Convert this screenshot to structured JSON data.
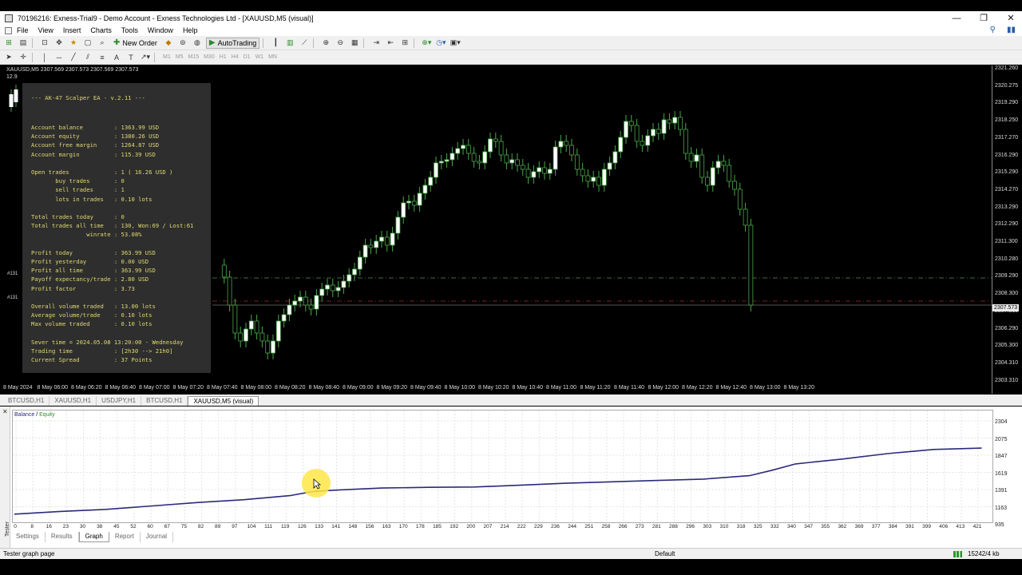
{
  "window": {
    "title": "70196216: Exness-Trial9 - Demo Account - Exness Technologies Ltd - [XAUUSD,M5 (visual)]",
    "controls": [
      "—",
      "❐",
      "✕"
    ]
  },
  "menu": [
    "File",
    "View",
    "Insert",
    "Charts",
    "Tools",
    "Window",
    "Help"
  ],
  "toolbar": {
    "new_order": "New Order",
    "autotrading": "AutoTrading",
    "timeframes": [
      "M1",
      "M5",
      "M15",
      "M30",
      "H1",
      "H4",
      "D1",
      "W1",
      "MN"
    ]
  },
  "chart": {
    "symbol_header": "XAUUSD,M5  2307.569 2307.573 2307.569 2307.573",
    "symbol_sub": "12.9",
    "current_price": "2307.573",
    "order_labels": [
      "#131",
      "#131"
    ],
    "price_labels": [
      "2321.260",
      "2320.275",
      "2319.290",
      "2318.250",
      "2317.270",
      "2316.290",
      "2315.290",
      "2314.270",
      "2313.290",
      "2312.290",
      "2311.300",
      "2310.280",
      "2309.290",
      "2308.300",
      "2307.310",
      "2306.290",
      "2305.300",
      "2304.310",
      "2303.310"
    ],
    "time_labels": [
      "8 May 2024",
      "8 May 06:00",
      "8 May 06:20",
      "8 May 06:40",
      "8 May 07:00",
      "8 May 07:20",
      "8 May 07:40",
      "8 May 08:00",
      "8 May 08:20",
      "8 May 08:40",
      "8 May 09:00",
      "8 May 09:20",
      "8 May 09:40",
      "8 May 10:00",
      "8 May 10:20",
      "8 May 10:40",
      "8 May 11:00",
      "8 May 11:20",
      "8 May 11:40",
      "8 May 12:00",
      "8 May 12:20",
      "8 May 12:40",
      "8 May 13:00",
      "8 May 13:20"
    ]
  },
  "ea_panel": {
    "title": "--- AK-47 Scalper EA - v.2.11 ---",
    "lines": [
      "Account balance         : 1363.99 USD",
      "Account equity          : 1380.26 USD",
      "Account free margin     : 1264.87 USD",
      "Account margin          : 115.39 USD",
      "",
      "Open trades             : 1 ( 16.26 USD )",
      "       buy trades       : 0",
      "       sell trades      : 1",
      "       lots in trades   : 0.10 lots",
      "",
      "Total trades today      : 0",
      "Total trades all time   : 130, Won:69 / Lost:61",
      "                winrate : 53.08%",
      "",
      "Profit today            : 363.99 USD",
      "Profit yesterday        : 0.00 USD",
      "Profit all time         : 363.99 USD",
      "Payoff expectancy/trade : 2.80 USD",
      "Profit factor           : 3.73",
      "",
      "Overall volume traded   : 13.00 lots",
      "Average volume/trade    : 0.10 lots",
      "Max volume traded       : 0.10 lots",
      "",
      "Sever time = 2024.05.08 13:20:00 - Wednesday",
      "Trading time            : [2h30 --> 21h0]",
      "Current Spread          : 37 Points"
    ]
  },
  "symbol_tabs": [
    "BTCUSD,H1",
    "XAUUSD,H1",
    "USDJPY,H1",
    "BTCUSD,H1",
    "XAUUSD,M5 (visual)"
  ],
  "active_symbol_tab": "XAUUSD,M5 (visual)",
  "tester": {
    "side_label": "Tester",
    "legend_balance": "Balance",
    "legend_sep": " / ",
    "legend_equity": "Equity",
    "y_labels": [
      "2304",
      "2075",
      "1847",
      "1619",
      "1391",
      "1163",
      "935"
    ],
    "x_labels": [
      "0",
      "8",
      "16",
      "23",
      "30",
      "38",
      "45",
      "52",
      "60",
      "67",
      "75",
      "82",
      "89",
      "97",
      "104",
      "111",
      "119",
      "126",
      "133",
      "141",
      "148",
      "156",
      "163",
      "170",
      "178",
      "185",
      "192",
      "200",
      "207",
      "214",
      "222",
      "229",
      "236",
      "244",
      "251",
      "258",
      "266",
      "273",
      "281",
      "288",
      "296",
      "303",
      "310",
      "318",
      "325",
      "332",
      "340",
      "347",
      "355",
      "362",
      "369",
      "377",
      "384",
      "391",
      "399",
      "406",
      "413",
      "421"
    ],
    "tabs": [
      "Settings",
      "Results",
      "Graph",
      "Report",
      "Journal"
    ],
    "active_tab": "Graph"
  },
  "chart_data": {
    "type": "line",
    "series": [
      {
        "name": "Balance",
        "x": [
          0,
          20,
          40,
          60,
          80,
          100,
          120,
          130,
          140,
          160,
          180,
          200,
          220,
          240,
          260,
          280,
          300,
          320,
          330,
          340,
          360,
          380,
          400,
          421
        ],
        "values": [
          960,
          1000,
          1030,
          1080,
          1130,
          1170,
          1230,
          1290,
          1310,
          1340,
          1350,
          1355,
          1380,
          1410,
          1430,
          1450,
          1470,
          1520,
          1600,
          1690,
          1760,
          1840,
          1900,
          1920
        ]
      }
    ],
    "ylim": [
      935,
      2304
    ],
    "xlim": [
      0,
      425
    ]
  },
  "status": {
    "left": "Tester graph page",
    "middle": "Default",
    "right": "15242/4 kb"
  },
  "colors": {
    "bull_candle": "#ffffff",
    "bear_candle": "#000000",
    "wick": "#4aa84a",
    "balance_line": "#2a2a7a"
  }
}
